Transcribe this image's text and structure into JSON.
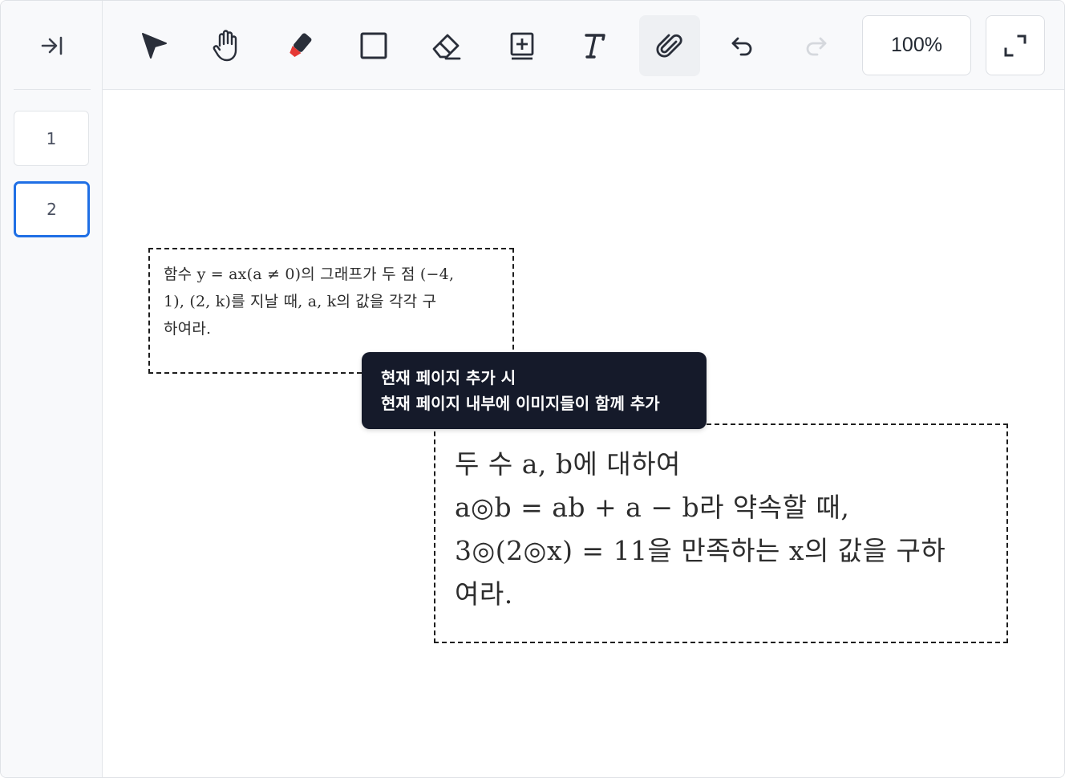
{
  "sidebar": {
    "collapse_icon": "collapse-right-icon",
    "pages": [
      {
        "label": "1",
        "active": false
      },
      {
        "label": "2",
        "active": true
      }
    ]
  },
  "toolbar": {
    "tools": [
      {
        "name": "select",
        "icon": "pointer-arrow-icon"
      },
      {
        "name": "pan",
        "icon": "hand-icon"
      },
      {
        "name": "highlighter",
        "icon": "marker-icon"
      },
      {
        "name": "rectangle",
        "icon": "square-icon"
      },
      {
        "name": "eraser",
        "icon": "eraser-icon"
      },
      {
        "name": "add-page",
        "icon": "add-box-icon"
      },
      {
        "name": "text",
        "icon": "text-icon"
      },
      {
        "name": "attach",
        "icon": "paperclip-icon",
        "active": true
      },
      {
        "name": "undo",
        "icon": "undo-icon"
      },
      {
        "name": "redo",
        "icon": "redo-icon",
        "disabled": true
      }
    ],
    "zoom_label": "100%",
    "expand_icon": "expand-icon"
  },
  "canvas": {
    "image_1": {
      "lines": [
        "함수  y = ax(a ≠ 0)의  그래프가  두  점  (−4,",
        "1),  (2,  k)를  지날  때,  a,  k의  값을  각각  구",
        "하여라."
      ]
    },
    "image_2": {
      "lines": [
        "두  수  a,  b에  대하여",
        "a◎b = ab + a − b라  약속할  때,",
        "3◎(2◎x) = 11을  만족하는  x의  값을  구하",
        "여라."
      ]
    },
    "tooltip": {
      "line1": "현재 페이지 추가 시",
      "line2": "현재 페이지 내부에 이미지들이 함께 추가"
    }
  },
  "colors": {
    "accent": "#1f6fe5",
    "tooltip_bg": "#151a2a",
    "marker_tip": "#e53935"
  }
}
